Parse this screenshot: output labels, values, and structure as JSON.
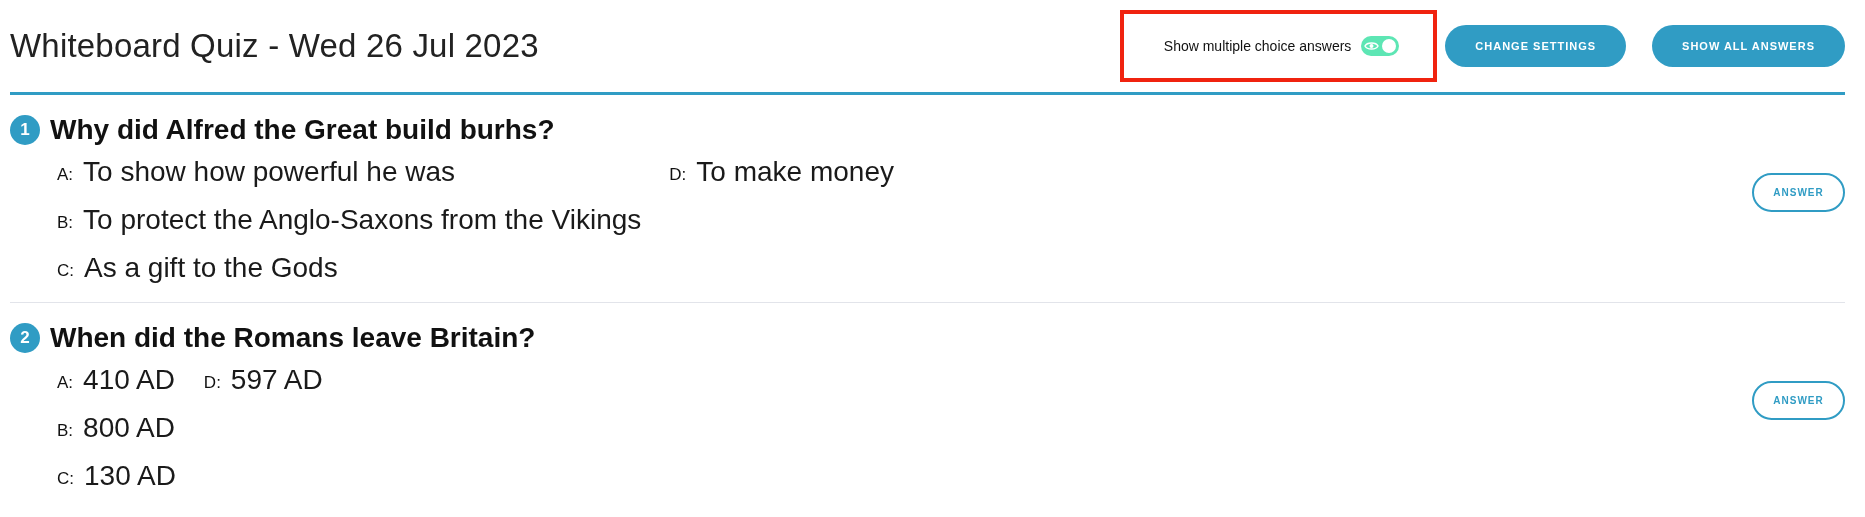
{
  "header": {
    "title": "Whiteboard Quiz - Wed 26 Jul 2023"
  },
  "toggle": {
    "label": "Show multiple choice answers",
    "on": true,
    "highlighted": true
  },
  "buttons": [
    "CHANGE SETTINGS",
    "SHOW ALL ANSWERS"
  ],
  "questions": [
    {
      "number": "1",
      "text": "Why did Alfred the Great build burhs?",
      "answer_button": "ANSWER",
      "options": [
        {
          "letter": "A:",
          "text": "To show how powerful he was"
        },
        {
          "letter": "B:",
          "text": "To protect the Anglo-Saxons from the Vikings"
        },
        {
          "letter": "C:",
          "text": "As a gift to the Gods"
        },
        {
          "letter": "D:",
          "text": "To make money"
        }
      ]
    },
    {
      "number": "2",
      "text": "When did the Romans leave Britain?",
      "answer_button": "ANSWER",
      "options": [
        {
          "letter": "A:",
          "text": "410 AD"
        },
        {
          "letter": "B:",
          "text": "800 AD"
        },
        {
          "letter": "C:",
          "text": "130 AD"
        },
        {
          "letter": "D:",
          "text": "597 AD"
        }
      ]
    }
  ]
}
